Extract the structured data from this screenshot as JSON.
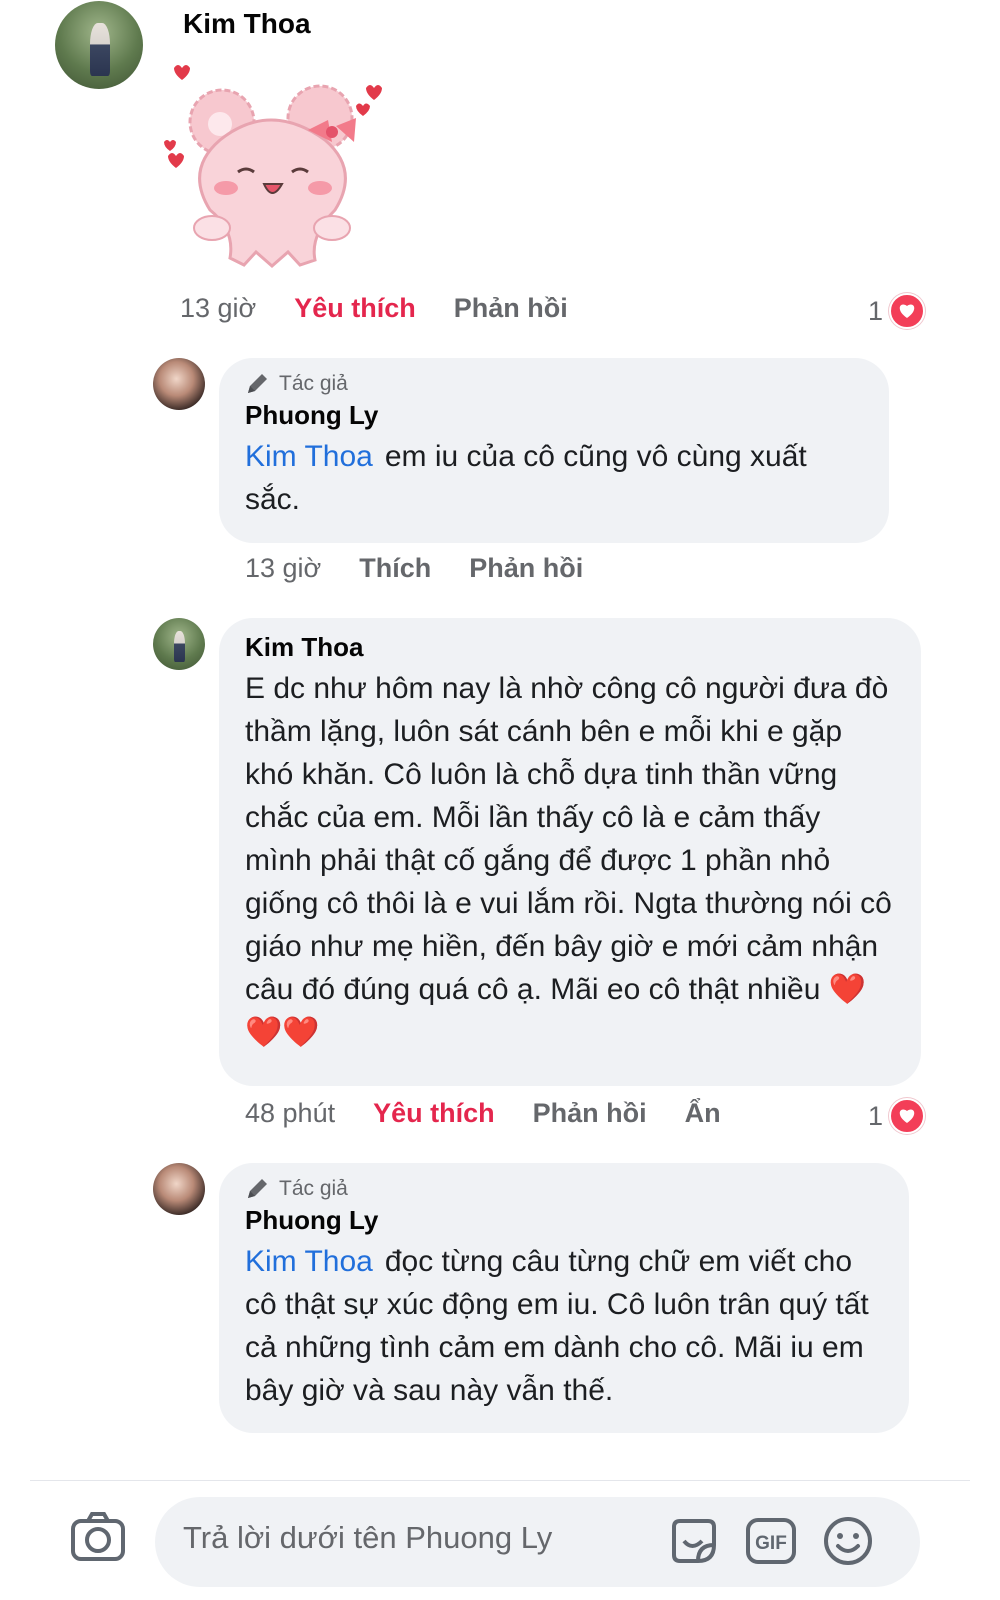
{
  "comments": [
    {
      "author": "Kim Thoa",
      "sticker": "pink-bear-sticker",
      "time": "13 giờ",
      "like_label": "Yêu thích",
      "reply_label": "Phản hồi",
      "reaction_count": "1"
    },
    {
      "author_tag": "Tác giả",
      "author": "Phuong Ly",
      "mention": "Kim Thoa",
      "text": "em iu của cô cũng vô cùng xuất sắc.",
      "time": "13 giờ",
      "like_label": "Thích",
      "reply_label": "Phản hồi"
    },
    {
      "author": "Kim Thoa",
      "text": "E dc như hôm nay là nhờ công cô người đưa đò thầm lặng, luôn sát cánh bên e mỗi khi e gặp khó khăn. Cô luôn là chỗ dựa tinh thần vững chắc của em. Mỗi lần thấy cô là e cảm thấy mình phải thật cố gắng để được 1 phần nhỏ giống cô thôi là e vui lắm rồi. Ngta thường nói cô giáo như mẹ hiền, đến bây giờ e mới cảm nhận câu đó đúng quá cô ạ. Mãi eo cô thật nhiều",
      "emoji": "❤️❤️❤️",
      "time": "48 phút",
      "like_label": "Yêu thích",
      "reply_label": "Phản hồi",
      "hide_label": "Ẩn",
      "reaction_count": "1"
    },
    {
      "author_tag": "Tác giả",
      "author": "Phuong Ly",
      "mention": "Kim Thoa",
      "text": "đọc từng câu từng chữ em viết cho cô thật sự xúc động em iu. Cô luôn trân quý tất cả những tình cảm em dành cho cô. Mãi iu em bây giờ và sau này vẫn thế."
    }
  ],
  "composer": {
    "placeholder": "Trả lời dưới tên Phuong Ly",
    "icons": [
      "camera-icon",
      "sticker-icon",
      "gif-icon",
      "emoji-icon"
    ],
    "gif_label": "GIF"
  },
  "colors": {
    "liked": "#e4264d",
    "mention": "#216fdb",
    "bubble": "#f0f2f5",
    "heart": "#f33e58"
  }
}
